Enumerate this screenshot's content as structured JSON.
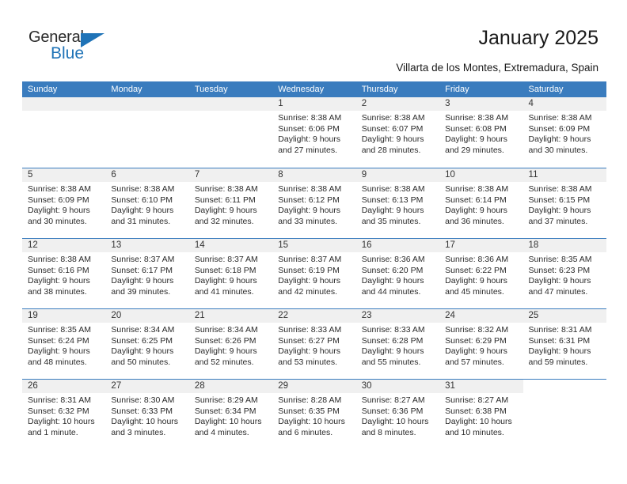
{
  "brand": {
    "name_top": "General",
    "name_bottom": "Blue",
    "accent_color": "#1f73b7",
    "text_color": "#2b2b2b"
  },
  "header": {
    "title": "January 2025",
    "subtitle": "Villarta de los Montes, Extremadura, Spain"
  },
  "calendar": {
    "header_color": "#3a7cbe",
    "daynum_band_color": "#f0f0f0",
    "weekdays": [
      "Sunday",
      "Monday",
      "Tuesday",
      "Wednesday",
      "Thursday",
      "Friday",
      "Saturday"
    ],
    "weeks": [
      [
        {
          "day": "",
          "kind": "blank",
          "lines": []
        },
        {
          "day": "",
          "kind": "blank",
          "lines": []
        },
        {
          "day": "",
          "kind": "blank",
          "lines": []
        },
        {
          "day": "1",
          "kind": "day",
          "lines": [
            "Sunrise: 8:38 AM",
            "Sunset: 6:06 PM",
            "Daylight: 9 hours",
            "and 27 minutes."
          ]
        },
        {
          "day": "2",
          "kind": "day",
          "lines": [
            "Sunrise: 8:38 AM",
            "Sunset: 6:07 PM",
            "Daylight: 9 hours",
            "and 28 minutes."
          ]
        },
        {
          "day": "3",
          "kind": "day",
          "lines": [
            "Sunrise: 8:38 AM",
            "Sunset: 6:08 PM",
            "Daylight: 9 hours",
            "and 29 minutes."
          ]
        },
        {
          "day": "4",
          "kind": "day",
          "lines": [
            "Sunrise: 8:38 AM",
            "Sunset: 6:09 PM",
            "Daylight: 9 hours",
            "and 30 minutes."
          ]
        }
      ],
      [
        {
          "day": "5",
          "kind": "day",
          "lines": [
            "Sunrise: 8:38 AM",
            "Sunset: 6:09 PM",
            "Daylight: 9 hours",
            "and 30 minutes."
          ]
        },
        {
          "day": "6",
          "kind": "day",
          "lines": [
            "Sunrise: 8:38 AM",
            "Sunset: 6:10 PM",
            "Daylight: 9 hours",
            "and 31 minutes."
          ]
        },
        {
          "day": "7",
          "kind": "day",
          "lines": [
            "Sunrise: 8:38 AM",
            "Sunset: 6:11 PM",
            "Daylight: 9 hours",
            "and 32 minutes."
          ]
        },
        {
          "day": "8",
          "kind": "day",
          "lines": [
            "Sunrise: 8:38 AM",
            "Sunset: 6:12 PM",
            "Daylight: 9 hours",
            "and 33 minutes."
          ]
        },
        {
          "day": "9",
          "kind": "day",
          "lines": [
            "Sunrise: 8:38 AM",
            "Sunset: 6:13 PM",
            "Daylight: 9 hours",
            "and 35 minutes."
          ]
        },
        {
          "day": "10",
          "kind": "day",
          "lines": [
            "Sunrise: 8:38 AM",
            "Sunset: 6:14 PM",
            "Daylight: 9 hours",
            "and 36 minutes."
          ]
        },
        {
          "day": "11",
          "kind": "day",
          "lines": [
            "Sunrise: 8:38 AM",
            "Sunset: 6:15 PM",
            "Daylight: 9 hours",
            "and 37 minutes."
          ]
        }
      ],
      [
        {
          "day": "12",
          "kind": "day",
          "lines": [
            "Sunrise: 8:38 AM",
            "Sunset: 6:16 PM",
            "Daylight: 9 hours",
            "and 38 minutes."
          ]
        },
        {
          "day": "13",
          "kind": "day",
          "lines": [
            "Sunrise: 8:37 AM",
            "Sunset: 6:17 PM",
            "Daylight: 9 hours",
            "and 39 minutes."
          ]
        },
        {
          "day": "14",
          "kind": "day",
          "lines": [
            "Sunrise: 8:37 AM",
            "Sunset: 6:18 PM",
            "Daylight: 9 hours",
            "and 41 minutes."
          ]
        },
        {
          "day": "15",
          "kind": "day",
          "lines": [
            "Sunrise: 8:37 AM",
            "Sunset: 6:19 PM",
            "Daylight: 9 hours",
            "and 42 minutes."
          ]
        },
        {
          "day": "16",
          "kind": "day",
          "lines": [
            "Sunrise: 8:36 AM",
            "Sunset: 6:20 PM",
            "Daylight: 9 hours",
            "and 44 minutes."
          ]
        },
        {
          "day": "17",
          "kind": "day",
          "lines": [
            "Sunrise: 8:36 AM",
            "Sunset: 6:22 PM",
            "Daylight: 9 hours",
            "and 45 minutes."
          ]
        },
        {
          "day": "18",
          "kind": "day",
          "lines": [
            "Sunrise: 8:35 AM",
            "Sunset: 6:23 PM",
            "Daylight: 9 hours",
            "and 47 minutes."
          ]
        }
      ],
      [
        {
          "day": "19",
          "kind": "day",
          "lines": [
            "Sunrise: 8:35 AM",
            "Sunset: 6:24 PM",
            "Daylight: 9 hours",
            "and 48 minutes."
          ]
        },
        {
          "day": "20",
          "kind": "day",
          "lines": [
            "Sunrise: 8:34 AM",
            "Sunset: 6:25 PM",
            "Daylight: 9 hours",
            "and 50 minutes."
          ]
        },
        {
          "day": "21",
          "kind": "day",
          "lines": [
            "Sunrise: 8:34 AM",
            "Sunset: 6:26 PM",
            "Daylight: 9 hours",
            "and 52 minutes."
          ]
        },
        {
          "day": "22",
          "kind": "day",
          "lines": [
            "Sunrise: 8:33 AM",
            "Sunset: 6:27 PM",
            "Daylight: 9 hours",
            "and 53 minutes."
          ]
        },
        {
          "day": "23",
          "kind": "day",
          "lines": [
            "Sunrise: 8:33 AM",
            "Sunset: 6:28 PM",
            "Daylight: 9 hours",
            "and 55 minutes."
          ]
        },
        {
          "day": "24",
          "kind": "day",
          "lines": [
            "Sunrise: 8:32 AM",
            "Sunset: 6:29 PM",
            "Daylight: 9 hours",
            "and 57 minutes."
          ]
        },
        {
          "day": "25",
          "kind": "day",
          "lines": [
            "Sunrise: 8:31 AM",
            "Sunset: 6:31 PM",
            "Daylight: 9 hours",
            "and 59 minutes."
          ]
        }
      ],
      [
        {
          "day": "26",
          "kind": "day",
          "lines": [
            "Sunrise: 8:31 AM",
            "Sunset: 6:32 PM",
            "Daylight: 10 hours",
            "and 1 minute."
          ]
        },
        {
          "day": "27",
          "kind": "day",
          "lines": [
            "Sunrise: 8:30 AM",
            "Sunset: 6:33 PM",
            "Daylight: 10 hours",
            "and 3 minutes."
          ]
        },
        {
          "day": "28",
          "kind": "day",
          "lines": [
            "Sunrise: 8:29 AM",
            "Sunset: 6:34 PM",
            "Daylight: 10 hours",
            "and 4 minutes."
          ]
        },
        {
          "day": "29",
          "kind": "day",
          "lines": [
            "Sunrise: 8:28 AM",
            "Sunset: 6:35 PM",
            "Daylight: 10 hours",
            "and 6 minutes."
          ]
        },
        {
          "day": "30",
          "kind": "day",
          "lines": [
            "Sunrise: 8:27 AM",
            "Sunset: 6:36 PM",
            "Daylight: 10 hours",
            "and 8 minutes."
          ]
        },
        {
          "day": "31",
          "kind": "day",
          "lines": [
            "Sunrise: 8:27 AM",
            "Sunset: 6:38 PM",
            "Daylight: 10 hours",
            "and 10 minutes."
          ]
        },
        {
          "day": "",
          "kind": "empty",
          "lines": []
        }
      ]
    ]
  }
}
